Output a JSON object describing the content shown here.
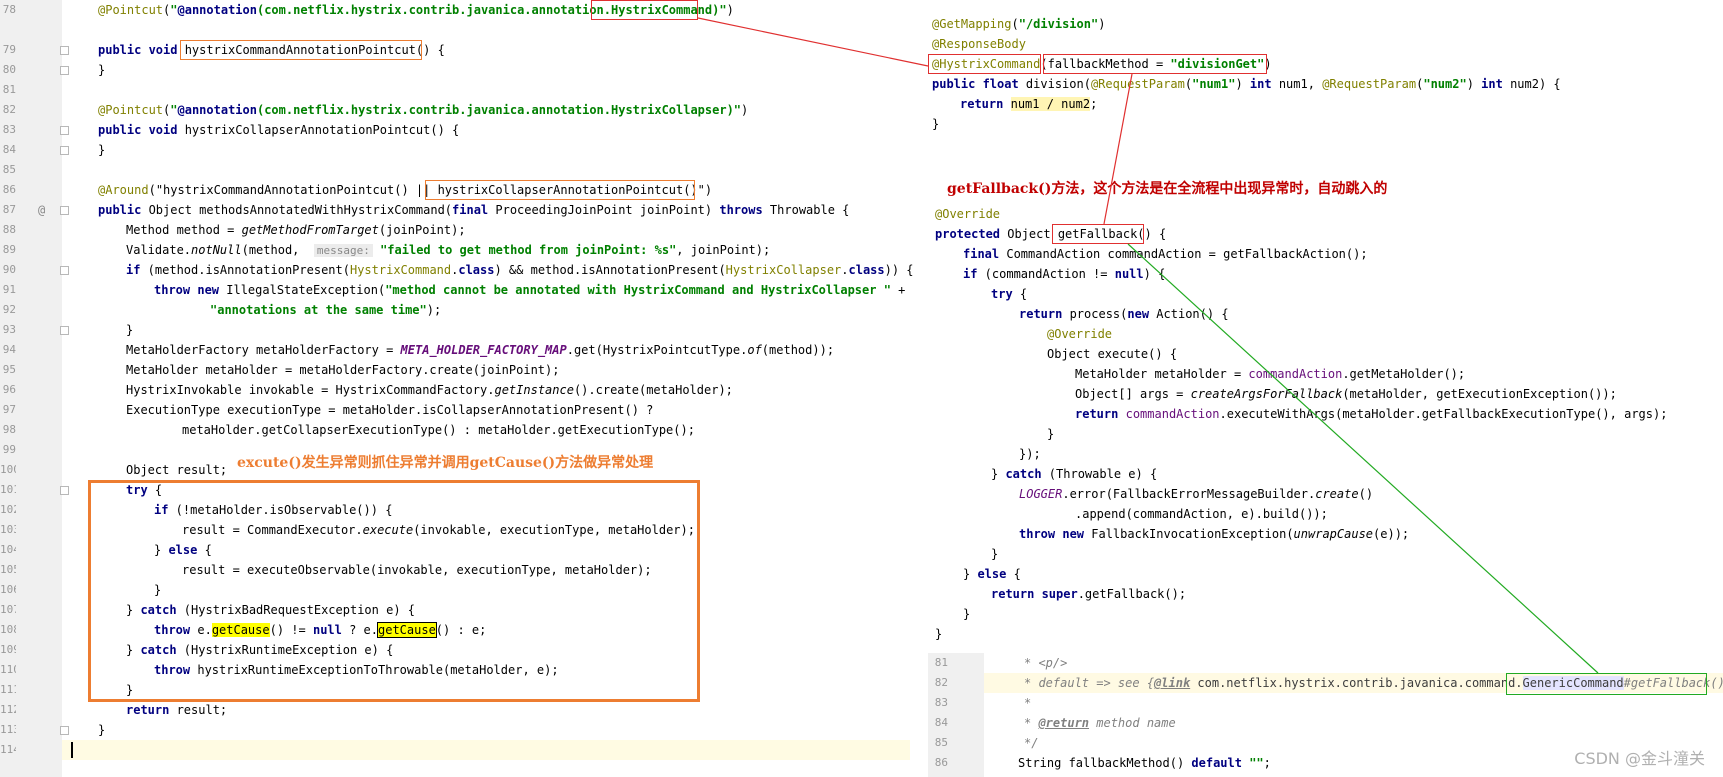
{
  "left_editor": {
    "line_numbers": [
      "78",
      "79",
      "80",
      "81",
      "82",
      "83",
      "84",
      "85",
      "86",
      "87",
      "88",
      "89",
      "90",
      "91",
      "92",
      "93",
      "94",
      "95",
      "96",
      "97",
      "98",
      "99",
      "100",
      "101",
      "102",
      "103",
      "104",
      "105",
      "106",
      "107",
      "108",
      "109",
      "110",
      "111",
      "112",
      "113",
      "114"
    ],
    "annotation_note": "excute()发生异常则抓住异常并调用getCause()方法做异常处理",
    "parameter_hint": "message:"
  },
  "right_editor": {
    "annotation_note": "getFallback()方法，这个方法是在全流程中出现异常时，自动跳入的"
  },
  "doc_editor": {
    "line_numbers": [
      "81",
      "82",
      "83",
      "84",
      "85",
      "86"
    ]
  },
  "watermark": "CSDN @金斗潼关",
  "colors": {
    "red_box": "#e03030",
    "orange_box": "#ed7d31",
    "green_box": "#22aa22",
    "gutter": "#f0f0f0"
  }
}
